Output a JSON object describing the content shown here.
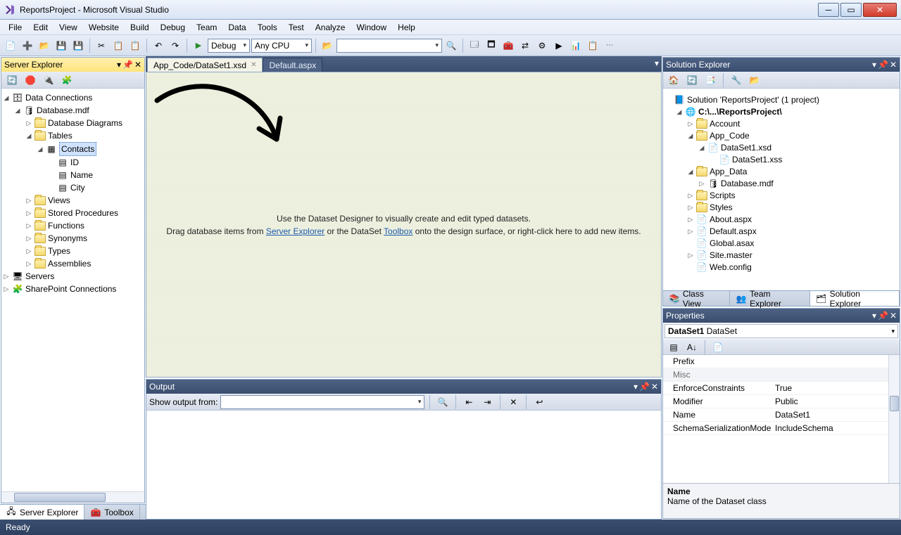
{
  "title": "ReportsProject - Microsoft Visual Studio",
  "menu": [
    "File",
    "Edit",
    "View",
    "Website",
    "Build",
    "Debug",
    "Team",
    "Data",
    "Tools",
    "Test",
    "Analyze",
    "Window",
    "Help"
  ],
  "toolbar": {
    "config": "Debug",
    "platform": "Any CPU"
  },
  "serverExplorer": {
    "title": "Server Explorer",
    "root": "Data Connections",
    "db": "Database.mdf",
    "folders": [
      "Database Diagrams",
      "Tables"
    ],
    "table": "Contacts",
    "columns": [
      "ID",
      "Name",
      "City"
    ],
    "moreFolders": [
      "Views",
      "Stored Procedures",
      "Functions",
      "Synonyms",
      "Types",
      "Assemblies"
    ],
    "servers": "Servers",
    "sp": "SharePoint Connections"
  },
  "bottomLeftTabs": [
    "Server Explorer",
    "Toolbox"
  ],
  "docTabs": {
    "active": "App_Code/DataSet1.xsd",
    "others": [
      "Default.aspx"
    ]
  },
  "designer": {
    "line1": "Use the Dataset Designer to visually create and edit typed datasets.",
    "line2a": "Drag database items from ",
    "link1": "Server Explorer",
    "line2b": " or the DataSet ",
    "link2": "Toolbox",
    "line2c": " onto the design surface, or right-click here to add new items."
  },
  "output": {
    "title": "Output",
    "label": "Show output from:"
  },
  "solutionExplorer": {
    "title": "Solution Explorer",
    "solution": "Solution 'ReportsProject' (1 project)",
    "project": "C:\\...\\ReportsProject\\",
    "folders": {
      "account": "Account",
      "appcode": "App_Code",
      "dataset": "DataSet1.xsd",
      "datasetxss": "DataSet1.xss",
      "appdata": "App_Data",
      "dbmdf": "Database.mdf",
      "scripts": "Scripts",
      "styles": "Styles"
    },
    "files": [
      "About.aspx",
      "Default.aspx",
      "Global.asax",
      "Site.master",
      "Web.config"
    ]
  },
  "rightTabs": [
    "Class View",
    "Team Explorer",
    "Solution Explorer"
  ],
  "properties": {
    "title": "Properties",
    "object": "DataSet1",
    "objectType": "DataSet",
    "rows": [
      {
        "k": "Prefix",
        "v": ""
      },
      {
        "k": "Misc",
        "v": "",
        "cat": true
      },
      {
        "k": "EnforceConstraints",
        "v": "True"
      },
      {
        "k": "Modifier",
        "v": "Public"
      },
      {
        "k": "Name",
        "v": "DataSet1"
      },
      {
        "k": "SchemaSerializationMode",
        "v": "IncludeSchema"
      }
    ],
    "desc": {
      "name": "Name",
      "text": "Name of the Dataset class"
    }
  },
  "status": "Ready"
}
